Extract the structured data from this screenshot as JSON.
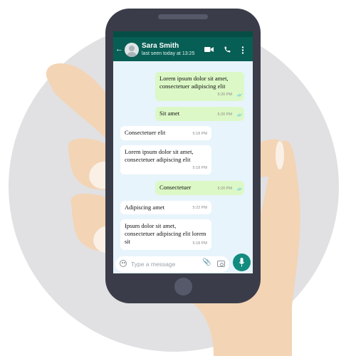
{
  "header": {
    "contact_name": "Sara Smith",
    "status": "last seen today at 13:25",
    "icons": [
      "back-arrow-icon",
      "video-call-icon",
      "phone-call-icon",
      "more-options-icon"
    ]
  },
  "messages": [
    {
      "direction": "out",
      "text": "Lorem ipsum dolor sit amet, consectetuer adipiscing elit",
      "time": "5:20 PM",
      "read": true
    },
    {
      "direction": "out",
      "text": "Sit amet",
      "time": "5:20 PM",
      "read": true
    },
    {
      "direction": "in",
      "text": "Consectetuer elit",
      "time": "5:18 PM"
    },
    {
      "direction": "in",
      "text": "Lorem ipsum dolor sit amet, consectetuer adipiscing elit",
      "time": "5:18 PM"
    },
    {
      "direction": "out",
      "text": "Consectetuer",
      "time": "5:20 PM",
      "read": true
    },
    {
      "direction": "in",
      "text": "Adipiscing amet",
      "time": "5:22 PM"
    },
    {
      "direction": "in",
      "text": "Ipsum dolor sit amet, consectetuer adipiscing elit lorem sit",
      "time": "5:18 PM"
    }
  ],
  "composer": {
    "placeholder": "Type a message",
    "icons": [
      "emoji-icon",
      "attach-icon",
      "camera-icon",
      "mic-icon"
    ]
  },
  "colors": {
    "header": "#075e54",
    "outgoing_bubble": "#dcf8c6",
    "incoming_bubble": "#ffffff",
    "chat_background": "#e8f4fb",
    "read_ticks": "#34b7f1",
    "mic_button": "#128c7e",
    "phone_body": "#3a3d49",
    "backdrop_circle": "#e1e1e3",
    "hand": "#f3d4b5"
  }
}
